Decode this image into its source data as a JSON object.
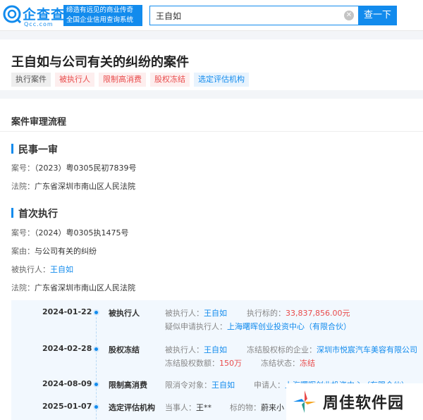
{
  "brand": {
    "logo_cn": "企查查",
    "logo_en": "Qcc.com",
    "slogan_line1": "缔造有远见的商业传奇",
    "slogan_line2": "全国企业信用查询系统"
  },
  "search": {
    "value": "王自如",
    "button": "查一下",
    "clear_icon": "close-circle-icon"
  },
  "title": "王自如与公司有关的纠纷的案件",
  "tags": [
    {
      "label": "执行案件",
      "style": "grey"
    },
    {
      "label": "被执行人",
      "style": "red"
    },
    {
      "label": "限制高消费",
      "style": "red"
    },
    {
      "label": "股权冻结",
      "style": "red"
    },
    {
      "label": "选定评估机构",
      "style": "blue"
    }
  ],
  "section_title": "案件审理流程",
  "stage1": {
    "title": "民事一审",
    "case_no_label": "案号：",
    "case_no": "（2023）粤0305民初7839号",
    "court_label": "法院：",
    "court": "广东省深圳市南山区人民法院"
  },
  "stage2": {
    "title": "首次执行",
    "case_no_label": "案号：",
    "case_no": "（2024）粤0305执1475号",
    "cause_label": "案由：",
    "cause": "与公司有关的纠纷",
    "executee_label": "被执行人：",
    "executee": "王自如",
    "court_label": "法院：",
    "court": "广东省深圳市南山区人民法院"
  },
  "timeline": [
    {
      "date": "2024-01-22",
      "type": "被执行人",
      "f1_label": "被执行人：",
      "f1_value": "王自如",
      "f2_label": "执行标的：",
      "f2_value": "33,837,856.00元",
      "f3_label": "疑似申请执行人：",
      "f3_value": "上海曙晖创业投资中心（有限合伙）"
    },
    {
      "date": "2024-02-28",
      "type": "股权冻结",
      "f1_label": "被执行人：",
      "f1_value": "王自如",
      "f2_label": "冻结股权标的企业：",
      "f2_value": "深圳市悦宸汽车美容有限公司",
      "f3_label": "冻结股权数额：",
      "f3_value": "150万",
      "f4_label": "冻结状态：",
      "f4_value": "冻结"
    },
    {
      "date": "2024-08-09",
      "type": "限制高消费",
      "f1_label": "限消令对象：",
      "f1_value": "王自如",
      "f2_label": "申请人：",
      "f2_value": "上海曙晖创业投资中心（有限合伙）"
    },
    {
      "date": "2025-01-07",
      "type": "选定评估机构",
      "f1_label": "当事人：",
      "f1_value": "王**",
      "f2_label": "标的物：",
      "f2_value": "蔚来小"
    }
  ],
  "watermark": {
    "text": "周佳软件园"
  },
  "colors": {
    "accent": "#128bed",
    "danger": "#e94b4b"
  }
}
